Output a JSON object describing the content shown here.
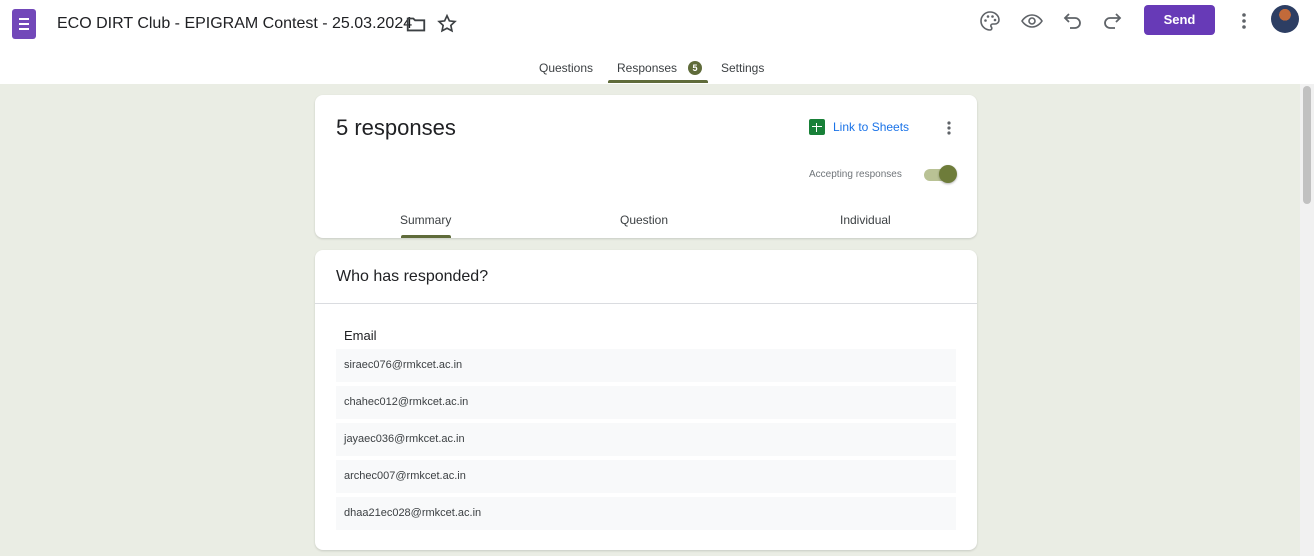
{
  "app": {
    "icon": "forms-list-icon",
    "title": "ECO DIRT Club - EPIGRAM Contest - 25.03.2024",
    "accent": "#673ab7",
    "theme": "#5f6b3a"
  },
  "toolbar": {
    "icons": [
      "palette-icon",
      "preview-eye-icon",
      "undo-icon",
      "redo-icon",
      "more-vert-icon"
    ],
    "send_label": "Send"
  },
  "tabs": {
    "questions": "Questions",
    "responses": "Responses",
    "responses_badge": "5",
    "settings": "Settings",
    "active": "Responses"
  },
  "summary_card": {
    "count_label": "5 responses",
    "link_label": "Link to Sheets",
    "accepting_label": "Accepting responses",
    "accepting": true,
    "subtabs": [
      "Summary",
      "Question",
      "Individual"
    ],
    "active_subtab": "Summary"
  },
  "respondents": {
    "title": "Who has responded?",
    "column": "Email",
    "emails": [
      "siraec076@rmkcet.ac.in",
      "chahec012@rmkcet.ac.in",
      "jayaec036@rmkcet.ac.in",
      "archec007@rmkcet.ac.in",
      "dhaa21ec028@rmkcet.ac.in"
    ]
  }
}
